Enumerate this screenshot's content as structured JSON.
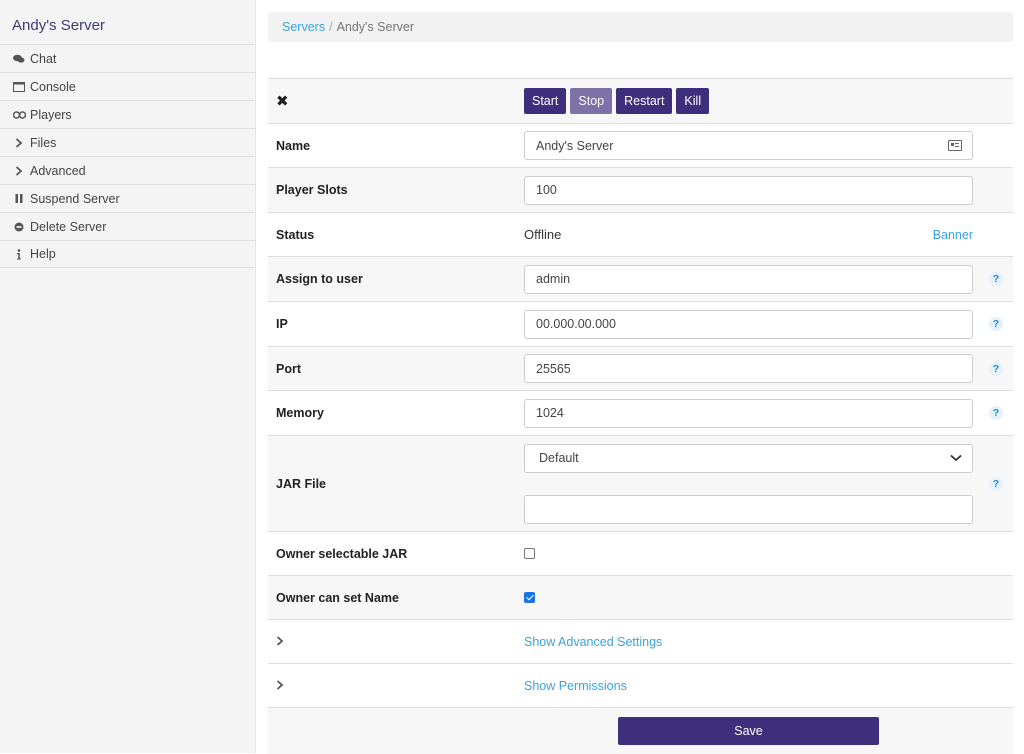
{
  "sidebar": {
    "title": "Andy's Server",
    "items": [
      {
        "label": "Chat",
        "icon": "chat-icon"
      },
      {
        "label": "Console",
        "icon": "console-icon"
      },
      {
        "label": "Players",
        "icon": "players-icon"
      },
      {
        "label": "Files",
        "icon": "chevron-right-icon"
      },
      {
        "label": "Advanced",
        "icon": "chevron-right-icon"
      },
      {
        "label": "Suspend Server",
        "icon": "pause-icon"
      },
      {
        "label": "Delete Server",
        "icon": "delete-icon"
      },
      {
        "label": "Help",
        "icon": "info-icon"
      }
    ]
  },
  "breadcrumb": {
    "root": "Servers",
    "sep": "/",
    "current": "Andy's Server"
  },
  "controls": {
    "close": "✖",
    "start": "Start",
    "stop": "Stop",
    "restart": "Restart",
    "kill": "Kill"
  },
  "form": {
    "name": {
      "label": "Name",
      "value": "Andy's Server"
    },
    "player_slots": {
      "label": "Player Slots",
      "value": "100"
    },
    "status": {
      "label": "Status",
      "value": "Offline",
      "link": "Banner"
    },
    "assign": {
      "label": "Assign to user",
      "value": "admin"
    },
    "ip": {
      "label": "IP",
      "value": "00.000.00.000"
    },
    "port": {
      "label": "Port",
      "value": "25565"
    },
    "memory": {
      "label": "Memory",
      "value": "1024"
    },
    "jar": {
      "label": "JAR File",
      "selected": "Default",
      "custom": ""
    },
    "owner_jar": {
      "label": "Owner selectable JAR",
      "checked": false
    },
    "owner_name": {
      "label": "Owner can set Name",
      "checked": true
    },
    "advanced": {
      "label": "Show Advanced Settings"
    },
    "permissions": {
      "label": "Show Permissions"
    },
    "help": "?",
    "chevron": "›"
  },
  "save": "Save",
  "colors": {
    "accent": "#3d2f7b",
    "accent_light": "#7d72a8",
    "link": "#3aa2e0"
  }
}
